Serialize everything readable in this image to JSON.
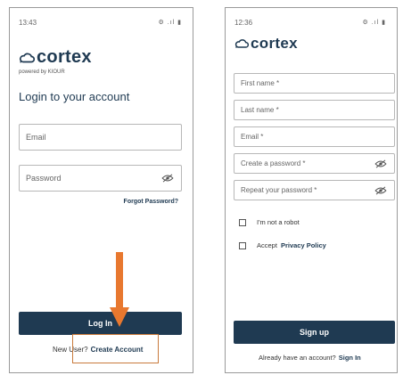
{
  "login_screen": {
    "status_time": "13:43",
    "status_icons": "⚙ .ıl ▮",
    "brand_name": "cortex",
    "powered_by": "powered by KIOUR",
    "title": "Login to your account",
    "email_placeholder": "Email",
    "password_placeholder": "Password",
    "forgot_password": "Forgot Password?",
    "login_button": "Log In",
    "new_user_text": "New User?",
    "create_account_link": "Create Account"
  },
  "signup_screen": {
    "status_time": "12:36",
    "status_icons": "⚙ .ıl ▮",
    "brand_name": "cortex",
    "first_name_placeholder": "First name *",
    "last_name_placeholder": "Last name *",
    "email_placeholder": "Email *",
    "create_password_placeholder": "Create a password *",
    "repeat_password_placeholder": "Repeat your password *",
    "robot_checkbox_label": "I'm not a robot",
    "accept_label": "Accept",
    "privacy_policy_link": "Privacy Policy",
    "signup_button": "Sign up",
    "have_account_text": "Already have an account?",
    "sign_in_link": "Sign In"
  },
  "colors": {
    "primary": "#1f3a52",
    "annotation_arrow": "#e8782f",
    "annotation_box": "#c97a3c"
  }
}
